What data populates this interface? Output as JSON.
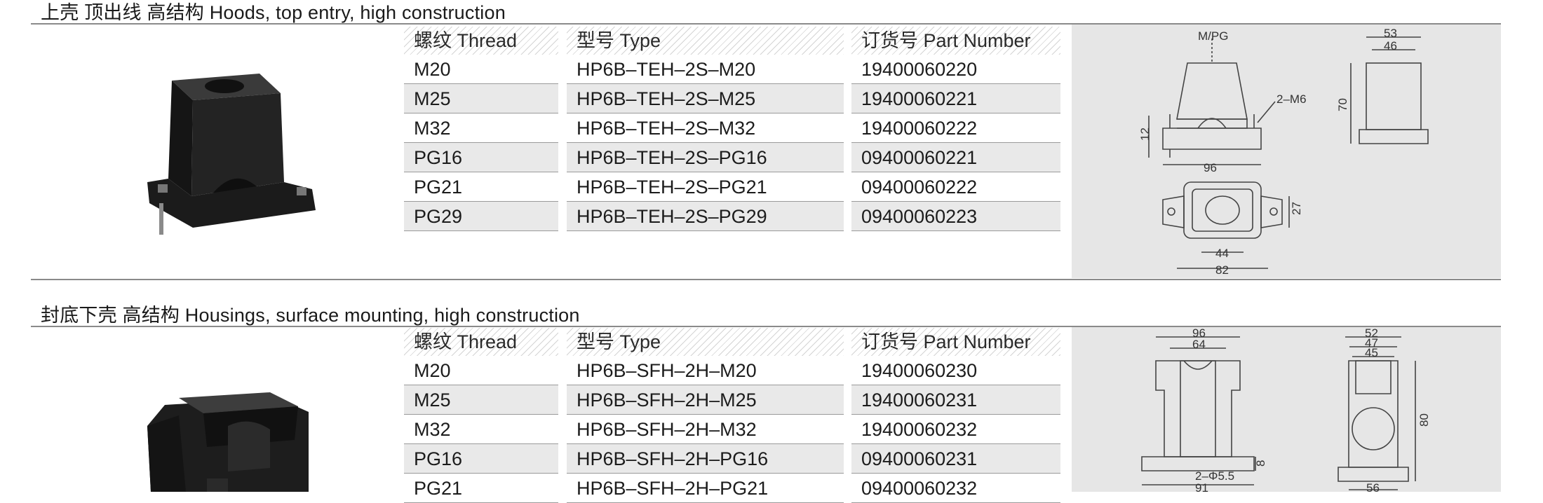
{
  "sections": [
    {
      "title": "上壳 顶出线 高结构 Hoods, top entry, high construction",
      "headers": {
        "thread": "螺纹 Thread",
        "type": "型号 Type",
        "part": "订货号 Part Number"
      },
      "rows": [
        {
          "thread": "M20",
          "type": "HP6B–TEH–2S–M20",
          "part": "19400060220"
        },
        {
          "thread": "M25",
          "type": "HP6B–TEH–2S–M25",
          "part": "19400060221"
        },
        {
          "thread": "M32",
          "type": "HP6B–TEH–2S–M32",
          "part": "19400060222"
        },
        {
          "thread": "PG16",
          "type": "HP6B–TEH–2S–PG16",
          "part": "09400060221"
        },
        {
          "thread": "PG21",
          "type": "HP6B–TEH–2S–PG21",
          "part": "09400060222"
        },
        {
          "thread": "PG29",
          "type": "HP6B–TEH–2S–PG29",
          "part": "09400060223"
        }
      ],
      "dims": {
        "mpg": "M/PG",
        "d53": "53",
        "d46": "46",
        "d12": "12",
        "m6": "2–M6",
        "d70": "70",
        "d96": "96",
        "d27": "27",
        "d44": "44",
        "d82": "82"
      }
    },
    {
      "title": "封底下壳 高结构 Housings, surface mounting, high construction",
      "headers": {
        "thread": "螺纹 Thread",
        "type": "型号 Type",
        "part": "订货号 Part Number"
      },
      "rows": [
        {
          "thread": "M20",
          "type": "HP6B–SFH–2H–M20",
          "part": "19400060230"
        },
        {
          "thread": "M25",
          "type": "HP6B–SFH–2H–M25",
          "part": "19400060231"
        },
        {
          "thread": "M32",
          "type": "HP6B–SFH–2H–M32",
          "part": "19400060232"
        },
        {
          "thread": "PG16",
          "type": "HP6B–SFH–2H–PG16",
          "part": "09400060231"
        },
        {
          "thread": "PG21",
          "type": "HP6B–SFH–2H–PG21",
          "part": "09400060232"
        }
      ],
      "dims": {
        "d96": "96",
        "d64": "64",
        "d52": "52",
        "d47": "47",
        "d45": "45",
        "d80": "80",
        "d8": "8",
        "hole": "2–Φ5.5",
        "d91": "91",
        "d56": "56"
      }
    }
  ]
}
